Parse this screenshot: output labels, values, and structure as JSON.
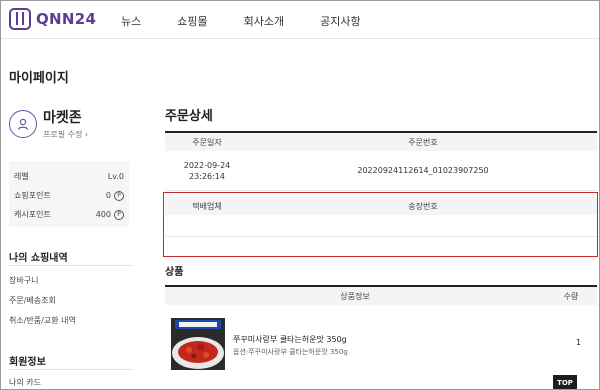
{
  "header": {
    "logo_text": "QNN24",
    "brand_color": "#5b3f8f",
    "nav": [
      "뉴스",
      "쇼핑몰",
      "회사소개",
      "공지사항"
    ]
  },
  "sidebar": {
    "title": "마이페이지",
    "profile": {
      "name": "마켓존",
      "edit_label": "프로필 수정 ›",
      "icon": "user-icon"
    },
    "points": [
      {
        "label": "레벨",
        "value": "Lv.0",
        "has_p": false
      },
      {
        "label": "쇼핑포인트",
        "value": "0",
        "has_p": true
      },
      {
        "label": "캐시포인트",
        "value": "400",
        "has_p": true
      }
    ],
    "section_shopping": "나의 쇼핑내역",
    "shopping_links": [
      "장바구니",
      "주문/배송조회",
      "취소/반품/교환 내역"
    ],
    "section_member": "회원정보",
    "member_links": [
      "나의 카드"
    ]
  },
  "main": {
    "order_title": "주문상세",
    "order_table": {
      "headers": [
        "주문일자",
        "주문번호"
      ],
      "date_line1": "2022-09-24",
      "date_line2": "23:26:14",
      "order_no": "20220924112614_01023907250"
    },
    "delivery_table": {
      "headers": [
        "택배업체",
        "송장번호"
      ]
    },
    "products_title": "상품",
    "product_table": {
      "headers": [
        "상품정보",
        "수량"
      ],
      "items": [
        {
          "name": "쭈꾸미사랑부 쿨타는허운맛 350g",
          "option": "옵션:쭈꾸미사랑부 쿨타는허운맛 350g",
          "qty": "1"
        }
      ]
    },
    "top_button": "TOP",
    "highlight_color": "#c52a2a"
  }
}
